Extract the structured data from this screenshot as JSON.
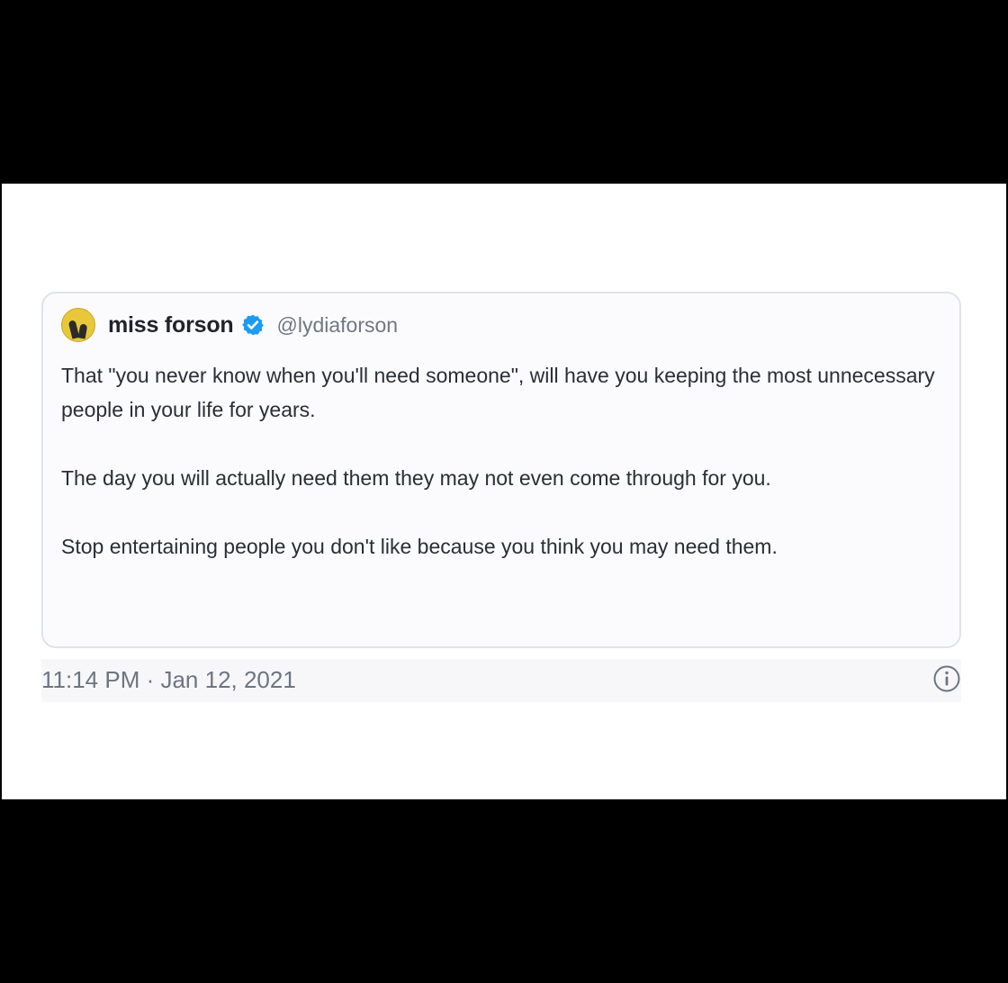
{
  "tweet": {
    "display_name": "miss forson",
    "handle": "@lydiaforson",
    "paragraphs": [
      "That \"you never know when you'll need someone\", will have you keeping the most unnecessary people in your life for years.",
      "The day you will actually need them they may not even come through for you.",
      "Stop entertaining people you don't like because you think you may need them."
    ],
    "timestamp": "11:14 PM · Jan 12, 2021",
    "icons": {
      "avatar": "avatar-image",
      "verified": "verified-badge-icon",
      "info": "info-icon"
    }
  },
  "colors": {
    "verified_blue": "#1d9bf0",
    "page_background": "#000000",
    "card_border": "#dfe3ea"
  }
}
